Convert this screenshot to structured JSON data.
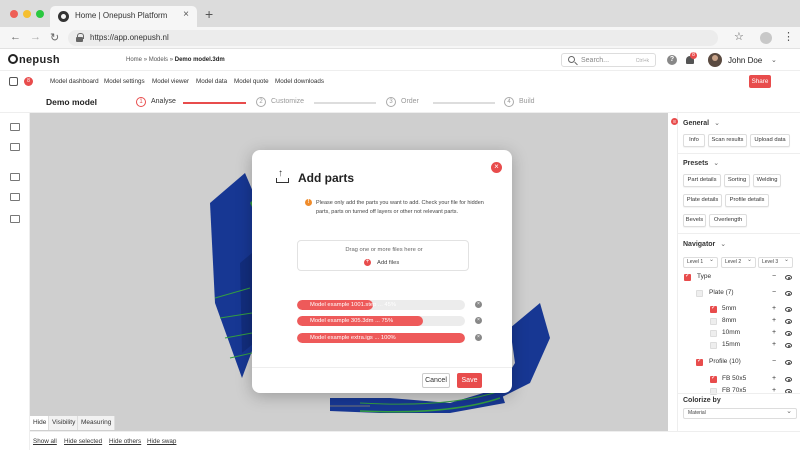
{
  "browser": {
    "tab_title": "Home | Onepush Platform",
    "tab_close": "×",
    "new_tab": "+",
    "url": "https://app.onepush.nl",
    "traffic_colors": [
      "#ee5f56",
      "#f5bf2f",
      "#2ac840"
    ]
  },
  "header": {
    "logo_text": "nepush",
    "breadcrumb": {
      "home": "Home",
      "sep1": "»",
      "models": "Models",
      "sep2": "»",
      "current": "Demo model.3dm"
    },
    "search": {
      "placeholder": "Search...",
      "shortcut": "Ctrl+k"
    },
    "help": "?",
    "notification_count": "8",
    "user_name": "John Doe"
  },
  "menu": {
    "badge": "8",
    "items": [
      "Model dashboard",
      "Model settings",
      "Model viewer",
      "Model data",
      "Model quote",
      "Model downloads"
    ],
    "share": "Share"
  },
  "steps": {
    "model_title": "Demo model",
    "items": [
      {
        "num": "1",
        "label": "Analyse",
        "active": true
      },
      {
        "num": "2",
        "label": "Customize",
        "active": false
      },
      {
        "num": "3",
        "label": "Order",
        "active": false
      },
      {
        "num": "4",
        "label": "Build",
        "active": false
      }
    ]
  },
  "modal": {
    "title": "Add parts",
    "info_icon": "!",
    "info": "Please only add the parts you want to add. Check your file for hidden parts, parts on turned off layers or other not relevant parts.",
    "drop_text": "Drag one or more files here or",
    "add_files": "Add files",
    "uploads": [
      {
        "label": "Model example 1001.step ... 45%",
        "progress": 0.45
      },
      {
        "label": "Model example 305.3dm ... 75%",
        "progress": 0.75
      },
      {
        "label": "Model example extra.igs ... 100%",
        "progress": 1.0
      }
    ],
    "cancel": "Cancel",
    "save": "Save"
  },
  "panel": {
    "general": {
      "title": "General",
      "badge": "8",
      "buttons": [
        "Info",
        "Scan results",
        "Upload data"
      ]
    },
    "presets": {
      "title": "Presets",
      "buttons": [
        "Part details",
        "Sorting",
        "Welding",
        "Plate details",
        "Profile details",
        "Bevels",
        "Overlength"
      ]
    },
    "navigator": {
      "title": "Navigator",
      "levels": [
        "Level 1",
        "Level 2",
        "Level 3"
      ],
      "tree": [
        {
          "label": "Type",
          "checked": true,
          "control": "−"
        },
        {
          "label": "Plate (7)",
          "checked": false,
          "control": "−"
        },
        {
          "label": "5mm",
          "checked": true,
          "control": "+"
        },
        {
          "label": "8mm",
          "checked": false,
          "control": "+"
        },
        {
          "label": "10mm",
          "checked": false,
          "control": "+"
        },
        {
          "label": "15mm",
          "checked": false,
          "control": "+"
        },
        {
          "label": "Profile (10)",
          "checked": true,
          "control": "−"
        },
        {
          "label": "FB 50x5",
          "checked": true,
          "control": "+"
        },
        {
          "label": "FB 70x5",
          "checked": false,
          "control": "+"
        }
      ]
    },
    "colorize": {
      "title": "Colorize by",
      "value": "Material"
    }
  },
  "bottom": {
    "tabs": [
      "Hide",
      "Visibility",
      "Measuring"
    ],
    "actions": [
      "Show all",
      "Hide selected",
      "Hide others",
      "Hide swap"
    ]
  },
  "colors": {
    "accent": "#e84c4c",
    "model_blue": "#1b3fa8",
    "model_green": "#3bb34a"
  }
}
